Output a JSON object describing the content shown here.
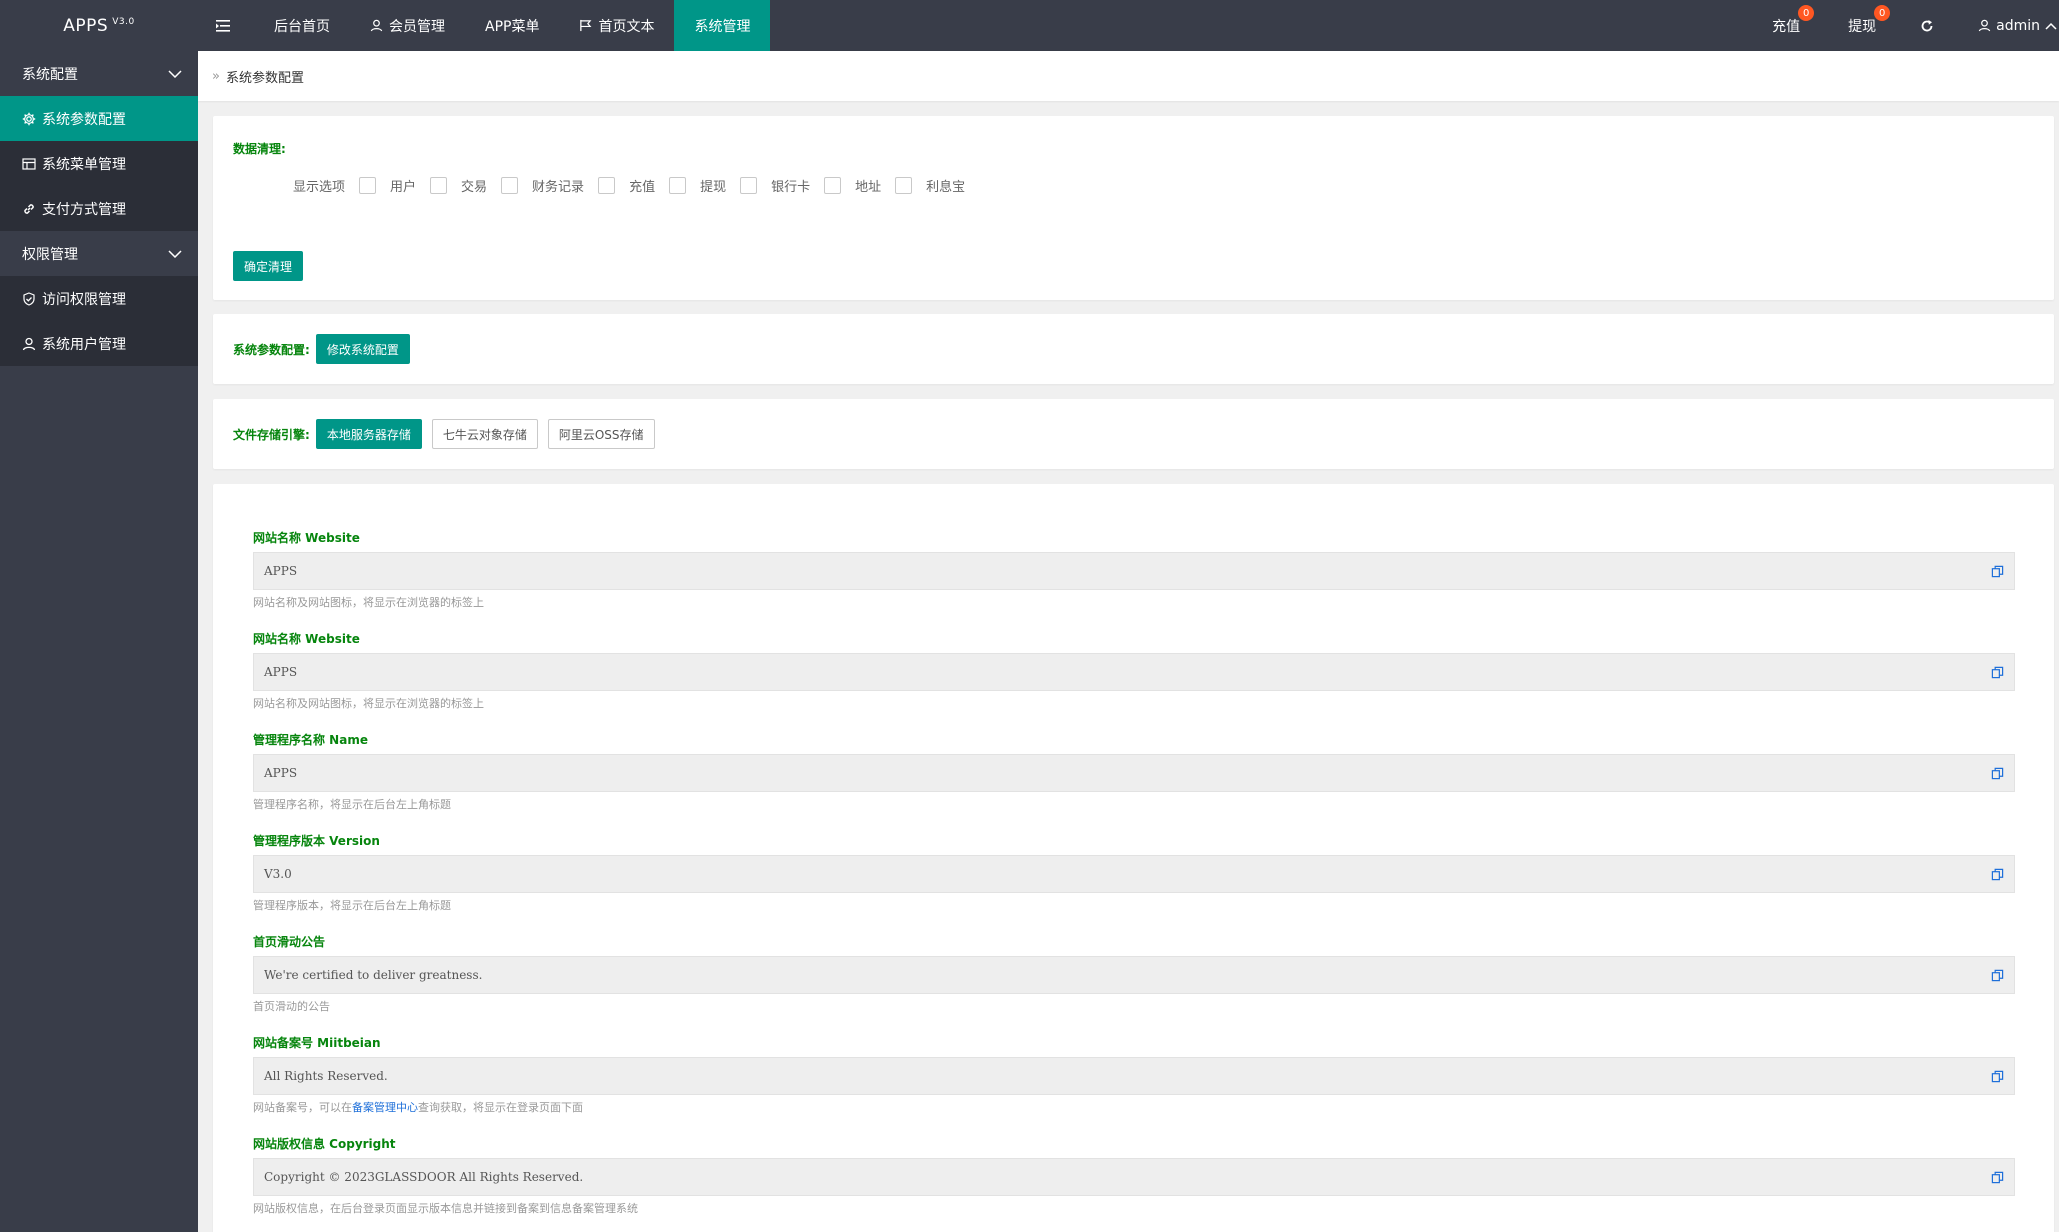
{
  "header": {
    "logo": "APPS",
    "version": "V3.0",
    "nav": [
      {
        "label": "后台首页"
      },
      {
        "label": "会员管理"
      },
      {
        "label": "APP菜单"
      },
      {
        "label": "首页文本"
      },
      {
        "label": "系统管理"
      }
    ],
    "right": {
      "recharge_label": "充值",
      "recharge_badge": "0",
      "withdraw_label": "提现",
      "withdraw_badge": "0",
      "user": "admin"
    }
  },
  "sidebar": {
    "group1": "系统配置",
    "items1": [
      "系统参数配置",
      "系统菜单管理",
      "支付方式管理"
    ],
    "group2": "权限管理",
    "items2": [
      "访问权限管理",
      "系统用户管理"
    ]
  },
  "breadcrumb": "系统参数配置",
  "clean": {
    "title": "数据清理:",
    "options_label": "显示选项",
    "options": [
      "用户",
      "交易",
      "财务记录",
      "充值",
      "提现",
      "银行卡",
      "地址",
      "利息宝"
    ],
    "confirm_button": "确定清理"
  },
  "sysconfig": {
    "label": "系统参数配置:",
    "button": "修改系统配置"
  },
  "storage": {
    "label": "文件存储引擎:",
    "buttons": [
      "本地服务器存储",
      "七牛云对象存储",
      "阿里云OSS存储"
    ]
  },
  "fields": [
    {
      "label": "网站名称 Website",
      "value": "APPS",
      "help": "网站名称及网站图标，将显示在浏览器的标签上"
    },
    {
      "label": "网站名称 Website",
      "value": "APPS",
      "help": "网站名称及网站图标，将显示在浏览器的标签上"
    },
    {
      "label": "管理程序名称 Name",
      "value": "APPS",
      "help": "管理程序名称，将显示在后台左上角标题"
    },
    {
      "label": "管理程序版本 Version",
      "value": "V3.0",
      "help": "管理程序版本，将显示在后台左上角标题"
    },
    {
      "label": "首页滑动公告",
      "value": "We're certified to deliver greatness.",
      "help": "首页滑动的公告"
    },
    {
      "label": "网站备案号 Miitbeian",
      "value": "All Rights Reserved.",
      "help_pre": "网站备案号，可以在",
      "help_link": "备案管理中心",
      "help_post": "查询获取，将显示在登录页面下面"
    },
    {
      "label": "网站版权信息 Copyright",
      "value": "Copyright © 2023GLASSDOOR All Rights Reserved.",
      "help": "网站版权信息，在后台登录页面显示版本信息并链接到备案到信息备案管理系统"
    }
  ],
  "colors": {
    "accent": "#009688",
    "header": "#393d49",
    "label_green": "#06850d",
    "badge": "#ff5722"
  }
}
